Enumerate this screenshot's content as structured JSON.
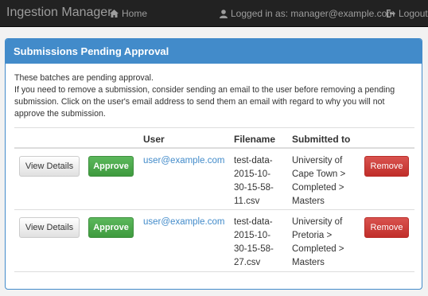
{
  "navbar": {
    "brand": "Ingestion Manager",
    "home_label": "Home",
    "user_label": "Logged in as: manager@example.com",
    "logout_label": "Logout"
  },
  "panel": {
    "title": "Submissions Pending Approval",
    "intro_line1": "These batches are pending approval.",
    "intro_line2": "If you need to remove a submission, consider sending an email to the user before removing a pending submission. Click on the user's email address to send them an email with regard to why you will not approve the submission."
  },
  "table": {
    "headers": [
      "",
      "",
      "User",
      "Filename",
      "Submitted to",
      ""
    ],
    "rows": [
      {
        "view_label": "View Details",
        "approve_label": "Approve",
        "user": "user@example.com",
        "filename_lines": [
          "test-data-",
          "2015-10-",
          "30-15-58-",
          "11.csv"
        ],
        "dest_lines": [
          "University of",
          "Cape Town >",
          "Completed >",
          "Masters"
        ],
        "remove_label": "Remove"
      },
      {
        "view_label": "View Details",
        "approve_label": "Approve",
        "user": "user@example.com",
        "filename_lines": [
          "test-data-",
          "2015-10-",
          "30-15-58-",
          "27.csv"
        ],
        "dest_lines": [
          "University of",
          "Pretoria >",
          "Completed >",
          "Masters"
        ],
        "remove_label": "Remove"
      }
    ]
  },
  "colors": {
    "navbar": "#222222",
    "primary": "#428bca",
    "success": "#5cb85c",
    "danger": "#d9534f"
  },
  "icons": {
    "home": "home-icon",
    "user": "user-icon",
    "logout": "logout-icon"
  }
}
